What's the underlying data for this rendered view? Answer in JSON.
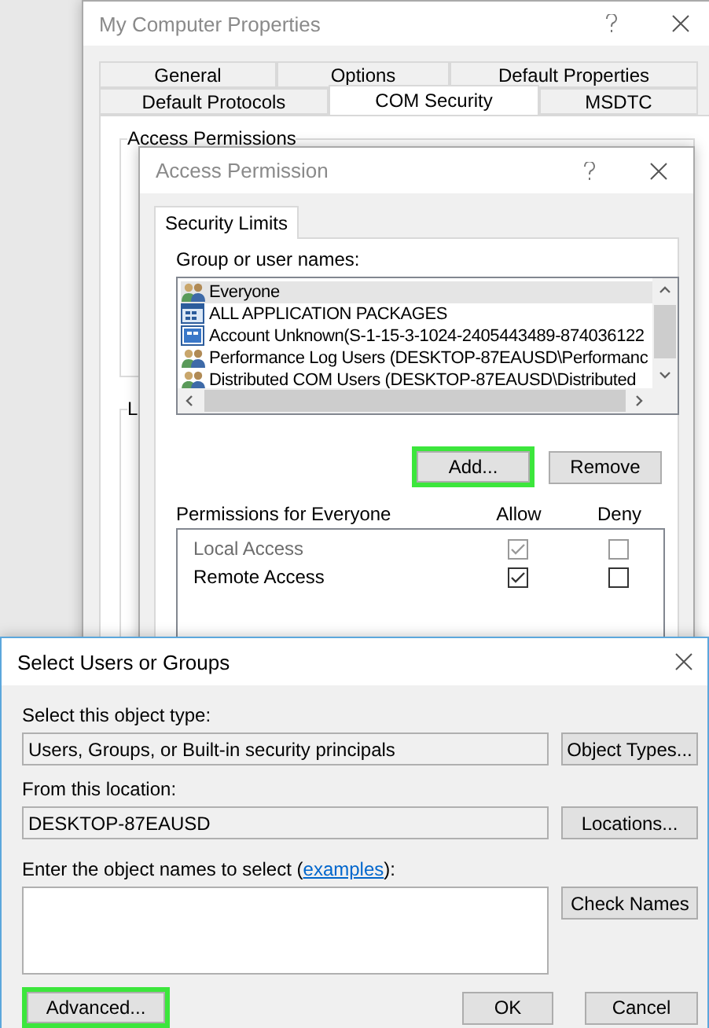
{
  "back_window": {
    "title": "My Computer Properties",
    "tab_rows": [
      [
        {
          "label": "General",
          "selected": false
        },
        {
          "label": "Options",
          "selected": false
        },
        {
          "label": "Default Properties",
          "selected": false
        }
      ],
      [
        {
          "label": "Default Protocols",
          "selected": false
        },
        {
          "label": "COM Security",
          "selected": true
        },
        {
          "label": "MSDTC",
          "selected": false
        }
      ]
    ],
    "groups": [
      {
        "label": "Access Permissions"
      },
      {
        "label": "L"
      }
    ]
  },
  "access_dialog": {
    "title": "Access Permission",
    "tab": {
      "label": "Security Limits",
      "selected": true
    },
    "names_label": "Group or user names:",
    "names": [
      {
        "kind": "group",
        "name": "Everyone",
        "selected": true
      },
      {
        "kind": "package",
        "name": "ALL APPLICATION PACKAGES",
        "selected": false
      },
      {
        "kind": "account",
        "name": "Account Unknown(S-1-15-3-1024-2405443489-874036122",
        "selected": false
      },
      {
        "kind": "group",
        "name": "Performance Log Users (DESKTOP-87EAUSD\\Performanc",
        "selected": false
      },
      {
        "kind": "group",
        "name": "Distributed COM Users (DESKTOP-87EAUSD\\Distributed",
        "selected": false
      }
    ],
    "buttons": [
      {
        "label": "Add...",
        "highlighted": true,
        "disabled": false
      },
      {
        "label": "Remove",
        "highlighted": false,
        "disabled": false
      }
    ],
    "permissions_label": "Permissions for Everyone",
    "allow_label": "Allow",
    "deny_label": "Deny",
    "permissions": [
      {
        "name": "Local Access",
        "disabled": true,
        "allow": true,
        "deny": false
      },
      {
        "name": "Remote Access",
        "disabled": false,
        "allow": true,
        "deny": false
      }
    ]
  },
  "select_dialog": {
    "title": "Select Users or Groups",
    "object_type": {
      "label": "Select this object type:",
      "value": "Users, Groups, or Built-in security principals",
      "button": "Object Types..."
    },
    "location": {
      "label": "From this location:",
      "value": "DESKTOP-87EAUSD",
      "button": "Locations..."
    },
    "names": {
      "label": "Enter the object names to select (",
      "link": "examples",
      "label_end": "):",
      "button": "Check Names"
    },
    "buttons": [
      {
        "label": "Advanced...",
        "highlighted": true
      },
      {
        "label": "OK",
        "highlighted": false
      },
      {
        "label": "Cancel",
        "highlighted": false
      }
    ]
  }
}
